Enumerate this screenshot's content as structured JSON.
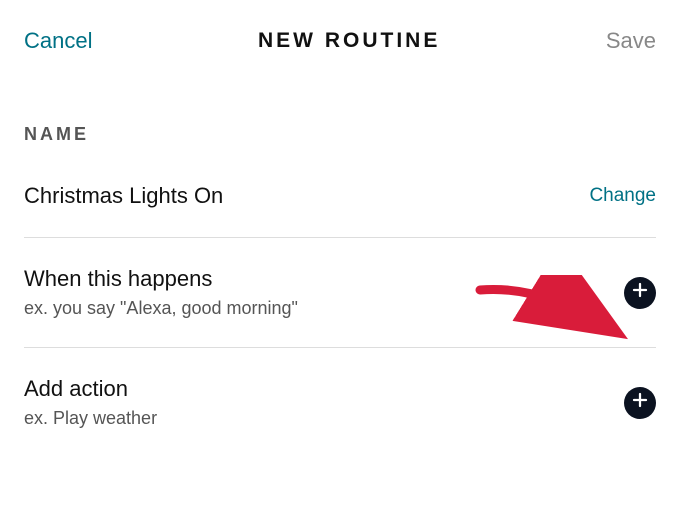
{
  "header": {
    "cancel_label": "Cancel",
    "title": "NEW ROUTINE",
    "save_label": "Save"
  },
  "name_section": {
    "label": "NAME",
    "value": "Christmas Lights On",
    "change_label": "Change"
  },
  "when_section": {
    "title": "When this happens",
    "subtitle": "ex. you say \"Alexa, good morning\""
  },
  "action_section": {
    "title": "Add action",
    "subtitle": "ex. Play weather"
  },
  "icons": {
    "plus": "plus-icon"
  },
  "colors": {
    "accent": "#007185",
    "plus_bg": "#0b1220",
    "arrow": "#d91c3a"
  }
}
